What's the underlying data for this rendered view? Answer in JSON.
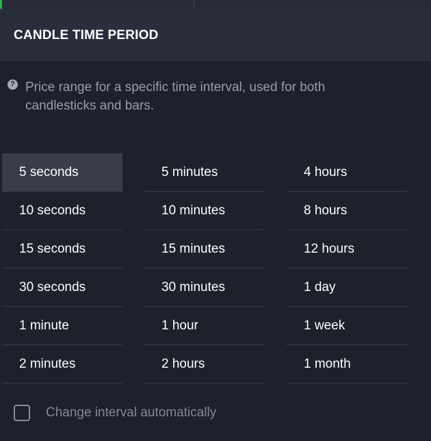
{
  "header": {
    "title": "CANDLE TIME PERIOD"
  },
  "help": {
    "icon": "help-circle-icon",
    "text": "Price range for a specific time interval, used for both candlesticks and bars."
  },
  "periods": {
    "selected": "5 seconds",
    "columns": [
      [
        "5 seconds",
        "10 seconds",
        "15 seconds",
        "30 seconds",
        "1 minute",
        "2 minutes"
      ],
      [
        "5 minutes",
        "10 minutes",
        "15 minutes",
        "30 minutes",
        "1 hour",
        "2 hours"
      ],
      [
        "4 hours",
        "8 hours",
        "12 hours",
        "1 day",
        "1 week",
        "1 month"
      ]
    ]
  },
  "auto_interval": {
    "label": "Change interval automatically",
    "checked": false
  },
  "colors": {
    "background": "#1e202c",
    "header": "#2a2d3b",
    "selected_row": "#393c4b",
    "accent_green": "#29b34a"
  }
}
